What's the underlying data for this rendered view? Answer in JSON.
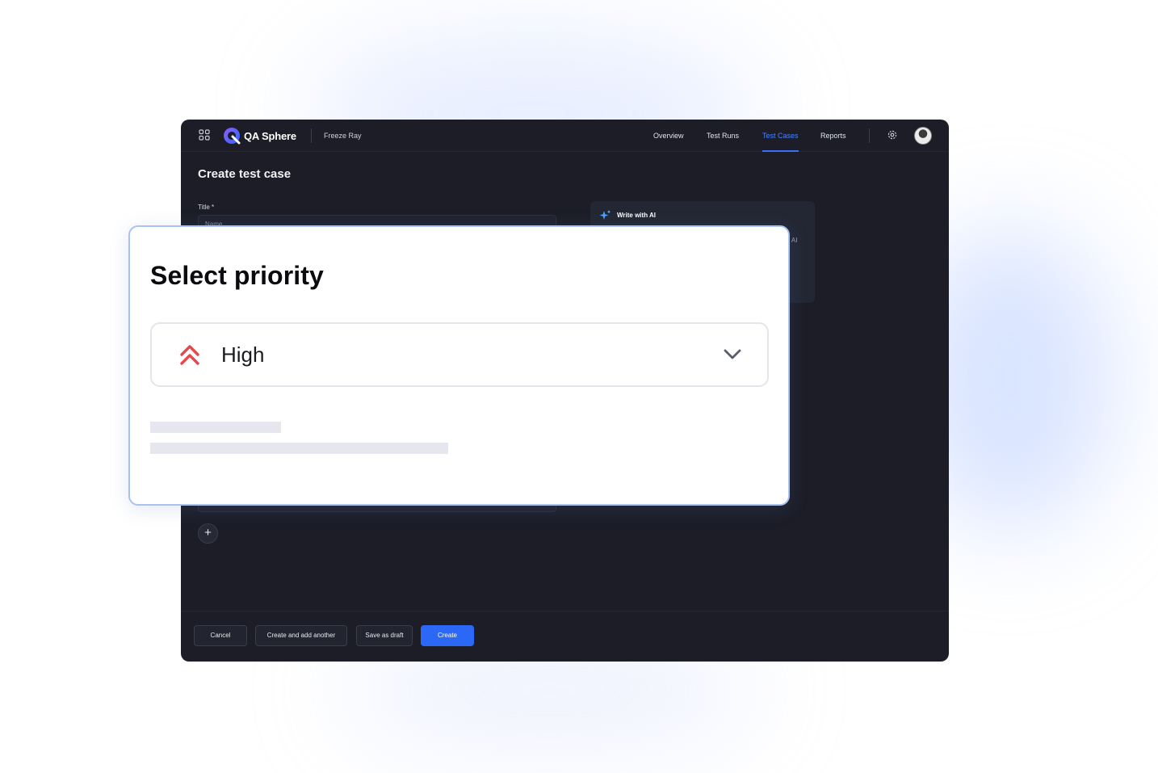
{
  "app": {
    "brand": "QA Sphere",
    "project": "Freeze Ray",
    "nav": [
      "Overview",
      "Test Runs",
      "Test Cases",
      "Reports"
    ],
    "active_nav": "Test Cases",
    "accent_color": "#3b6ff5"
  },
  "page": {
    "title": "Create test case",
    "title_label": "Title *",
    "title_placeholder": "Name"
  },
  "ai_panel": {
    "title": "Write with AI",
    "partial_text": "ur AI"
  },
  "footer": {
    "cancel": "Cancel",
    "create_another": "Create and add another",
    "save_draft": "Save as draft",
    "create": "Create"
  },
  "priority_card": {
    "title": "Select priority",
    "selected": "High",
    "icon": "double-chevron-up-icon",
    "icon_color": "#e5484d"
  }
}
